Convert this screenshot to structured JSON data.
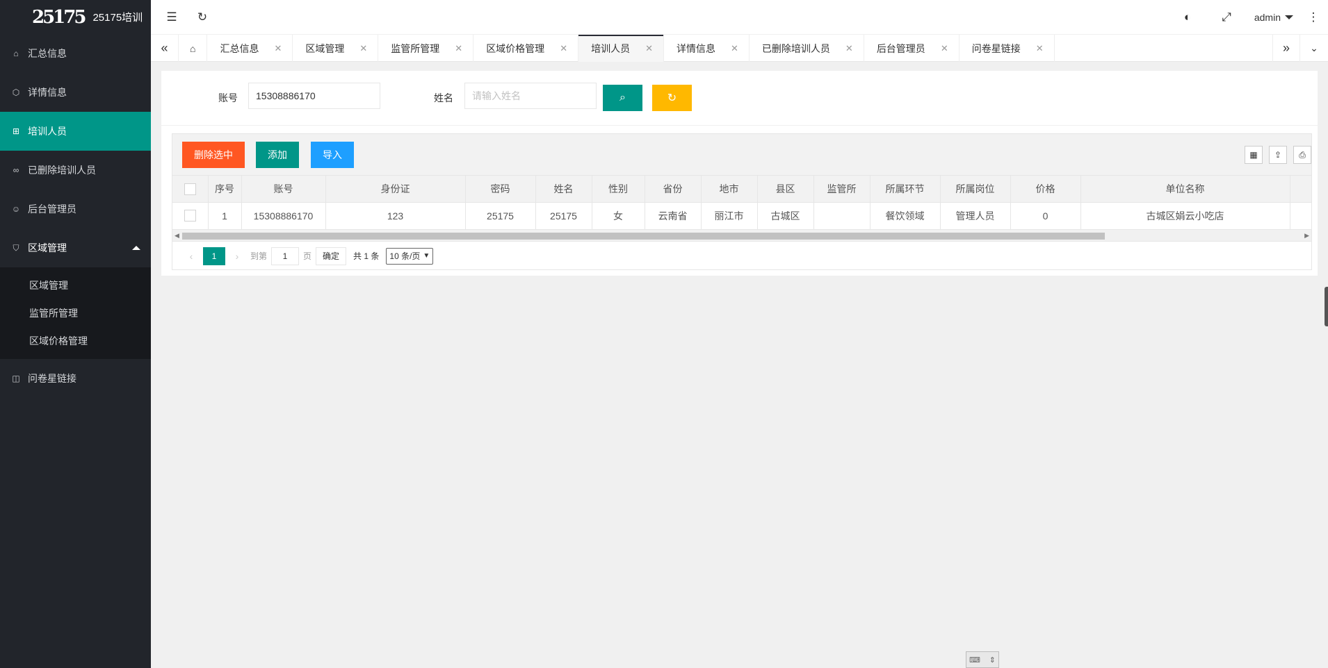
{
  "app": {
    "logo_mark": "25175",
    "title": "25175培训"
  },
  "sidebar": {
    "items": [
      {
        "label": "汇总信息",
        "icon": "home-icon"
      },
      {
        "label": "详情信息",
        "icon": "cube-icon"
      },
      {
        "label": "培训人员",
        "icon": "grid-icon"
      },
      {
        "label": "已删除培训人员",
        "icon": "link-icon"
      },
      {
        "label": "后台管理员",
        "icon": "user-icon"
      },
      {
        "label": "区域管理",
        "icon": "shield-icon"
      },
      {
        "label": "问卷星链接",
        "icon": "camera-icon"
      }
    ],
    "submenu": [
      "区域管理",
      "监管所管理",
      "区域价格管理"
    ]
  },
  "header": {
    "user": "admin"
  },
  "tabs": [
    {
      "label": "汇总信息"
    },
    {
      "label": "区域管理"
    },
    {
      "label": "监管所管理"
    },
    {
      "label": "区域价格管理"
    },
    {
      "label": "培训人员",
      "active": true
    },
    {
      "label": "详情信息"
    },
    {
      "label": "已删除培训人员"
    },
    {
      "label": "后台管理员"
    },
    {
      "label": "问卷星链接"
    }
  ],
  "search": {
    "account_label": "账号",
    "account_value": "15308886170",
    "name_label": "姓名",
    "name_placeholder": "请输入姓名"
  },
  "toolbar": {
    "delete_label": "删除选中",
    "add_label": "添加",
    "import_label": "导入"
  },
  "table": {
    "headers": [
      "序号",
      "账号",
      "身份证",
      "密码",
      "姓名",
      "性别",
      "省份",
      "地市",
      "县区",
      "监管所",
      "所属环节",
      "所属岗位",
      "价格",
      "单位名称"
    ],
    "rows": [
      [
        "1",
        "15308886170",
        "123",
        "25175",
        "25175",
        "女",
        "云南省",
        "丽江市",
        "古城区",
        "",
        "餐饮领域",
        "管理人员",
        "0",
        "古城区娟云小吃店"
      ]
    ]
  },
  "pager": {
    "current": "1",
    "goto_label": "到第",
    "goto_value": "1",
    "page_unit": "页",
    "confirm_label": "确定",
    "total": "共 1 条",
    "page_size": "10 条/页"
  },
  "colors": {
    "primary": "#009688",
    "danger": "#ff5722",
    "normal": "#1e9fff",
    "warm": "#ffb800",
    "sidebar_bg": "#22252b"
  }
}
